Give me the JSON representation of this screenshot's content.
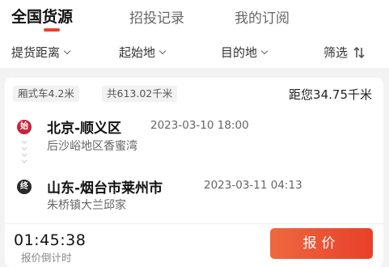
{
  "tabs": {
    "items": [
      {
        "label": "全国货源",
        "active": true
      },
      {
        "label": "招投记录",
        "active": false
      },
      {
        "label": "我的订阅",
        "active": false
      }
    ]
  },
  "filters": {
    "distance": "提货距离",
    "origin": "起始地",
    "destination": "目的地",
    "screen": "筛选"
  },
  "card": {
    "vehicle_tag": "厢式车4.2米",
    "total_distance_tag": "共613.02千米",
    "distance_from_you": "距您34.75千米",
    "start": {
      "badge": "始",
      "city": "北京-顺义区",
      "datetime": "2023-03-10 18:00",
      "address": "后沙峪地区香蜜湾"
    },
    "end": {
      "badge": "终",
      "city": "山东-烟台市莱州市",
      "datetime": "2023-03-11 04:13",
      "address": "朱桥镇大兰邱家"
    },
    "countdown": "01:45:38",
    "countdown_label": "报价倒计时",
    "quote_button": "报价"
  },
  "colors": {
    "accent": "#e8412c",
    "start_badge": "#c8243a",
    "end_badge": "#2a2a2a"
  }
}
